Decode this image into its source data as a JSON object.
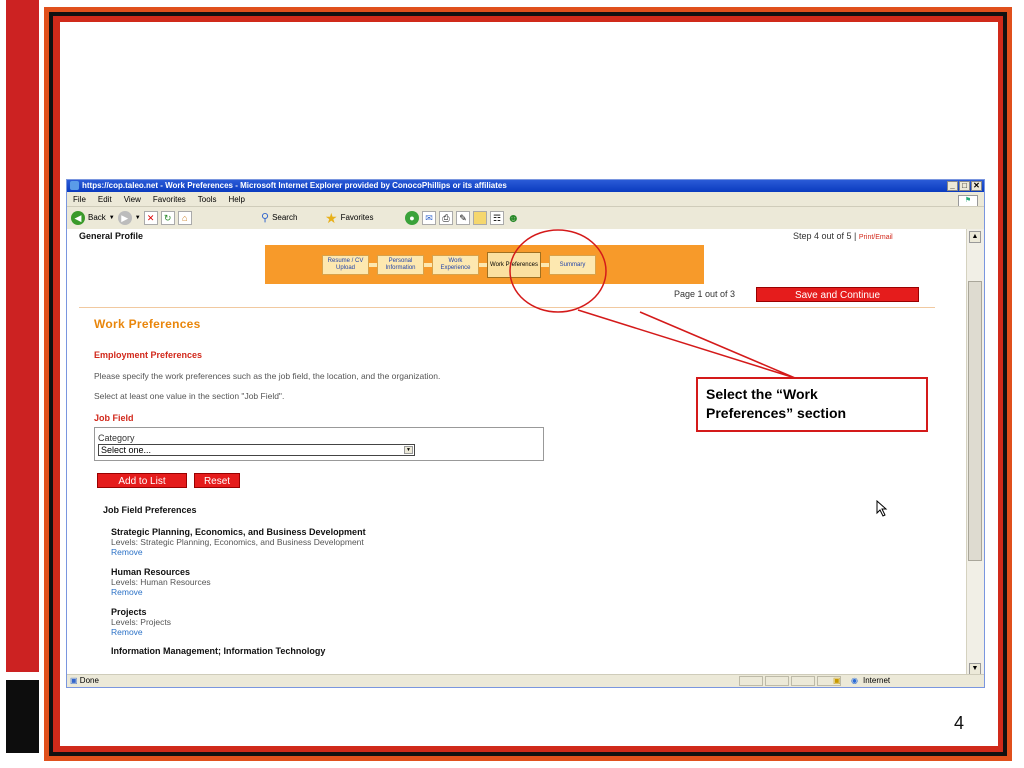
{
  "slide": {
    "page_number": "4"
  },
  "browser": {
    "title": "https://cop.taleo.net - Work Preferences - Microsoft Internet Explorer provided by ConocoPhillips or its affiliates",
    "window_buttons": [
      "_",
      "□",
      "✕"
    ],
    "menu": [
      "File",
      "Edit",
      "View",
      "Favorites",
      "Tools",
      "Help"
    ],
    "toolbar": {
      "back": "Back",
      "search": "Search",
      "favorites": "Favorites"
    },
    "status": {
      "left": "Done",
      "zone": "Internet"
    }
  },
  "page": {
    "section_title": "General Profile",
    "step": "Step 4 out of 5",
    "print_email": "Print/Email",
    "progress_steps": [
      {
        "label": "Resume / CV Upload",
        "active": false
      },
      {
        "label": "Personal Information",
        "active": false
      },
      {
        "label": "Work Experience",
        "active": false
      },
      {
        "label": "Work Preferences",
        "active": true
      },
      {
        "label": "Summary",
        "active": false
      }
    ],
    "page_count": "Page 1 out of 3",
    "save_button": "Save and Continue",
    "heading": "Work Preferences",
    "employment_heading": "Employment Preferences",
    "instruction1": "Please specify the work preferences such as the job field, the location, and the organization.",
    "instruction2": "Select at least one value in the section \"Job Field\".",
    "job_field_heading": "Job Field",
    "category_label": "Category",
    "category_select": "Select one...",
    "add_button": "Add to List",
    "reset_button": "Reset",
    "preferences_heading": "Job Field Preferences",
    "preferences": [
      {
        "title": "Strategic Planning, Economics, and Business Development",
        "levels": "Levels:  Strategic Planning, Economics, and Business Development",
        "remove": "Remove"
      },
      {
        "title": "Human Resources",
        "levels": "Levels:  Human Resources",
        "remove": "Remove"
      },
      {
        "title": "Projects",
        "levels": "Levels:  Projects",
        "remove": "Remove"
      },
      {
        "title": "Information Management; Information Technology",
        "levels": "",
        "remove": ""
      }
    ]
  },
  "callout": {
    "line1": "Select the “Work",
    "line2": "Preferences” section"
  },
  "colors": {
    "accent_red": "#d2281b",
    "progress_orange": "#f79a2a",
    "heading_orange": "#e9860b",
    "link_blue": "#2c72c7"
  }
}
